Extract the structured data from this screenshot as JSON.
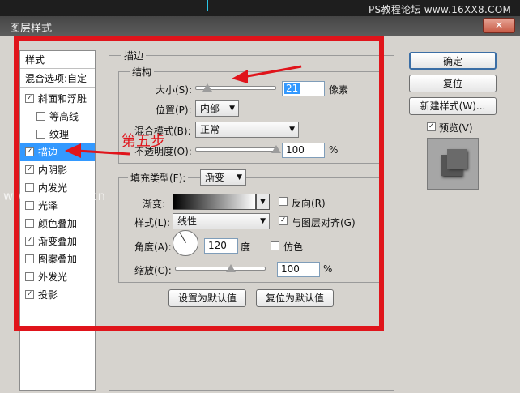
{
  "window": {
    "title": "图层样式",
    "close": "✕"
  },
  "watermark": {
    "top": "PS教程论坛 www.16XX8.COM",
    "middle": "www.ps-xxw.cn"
  },
  "styles": {
    "header": "样式",
    "blend_options": "混合选项:自定",
    "items": [
      {
        "label": "斜面和浮雕",
        "checked": true
      },
      {
        "label": "等高线",
        "checked": false
      },
      {
        "label": "纹理",
        "checked": false
      },
      {
        "label": "描边",
        "checked": true
      },
      {
        "label": "内阴影",
        "checked": true
      },
      {
        "label": "内发光",
        "checked": false
      },
      {
        "label": "光泽",
        "checked": false
      },
      {
        "label": "颜色叠加",
        "checked": false
      },
      {
        "label": "渐变叠加",
        "checked": true
      },
      {
        "label": "图案叠加",
        "checked": false
      },
      {
        "label": "外发光",
        "checked": false
      },
      {
        "label": "投影",
        "checked": true
      }
    ]
  },
  "stroke": {
    "title": "描边",
    "structure": {
      "title": "结构",
      "size_label": "大小(S):",
      "size_value": "21",
      "size_unit": "像素",
      "position_label": "位置(P):",
      "position_value": "内部",
      "blend_label": "混合模式(B):",
      "blend_value": "正常",
      "opacity_label": "不透明度(O):",
      "opacity_value": "100",
      "opacity_unit": "%"
    },
    "fill": {
      "type_label": "填充类型(F):",
      "type_value": "渐变",
      "gradient_label": "渐变:",
      "reverse_label": "反向(R)",
      "reverse_checked": false,
      "style_label": "样式(L):",
      "style_value": "线性",
      "align_label": "与图层对齐(G)",
      "align_checked": true,
      "angle_label": "角度(A):",
      "angle_value": "120",
      "angle_unit": "度",
      "dither_label": "仿色",
      "dither_checked": false,
      "scale_label": "缩放(C):",
      "scale_value": "100",
      "scale_unit": "%"
    },
    "set_default": "设置为默认值",
    "reset_default": "复位为默认值"
  },
  "buttons": {
    "ok": "确定",
    "reset": "复位",
    "new_style": "新建样式(W)...",
    "preview_label": "预览(V)",
    "preview_checked": true
  },
  "annotation": {
    "step": "第五步",
    "color": "#e0141b"
  }
}
